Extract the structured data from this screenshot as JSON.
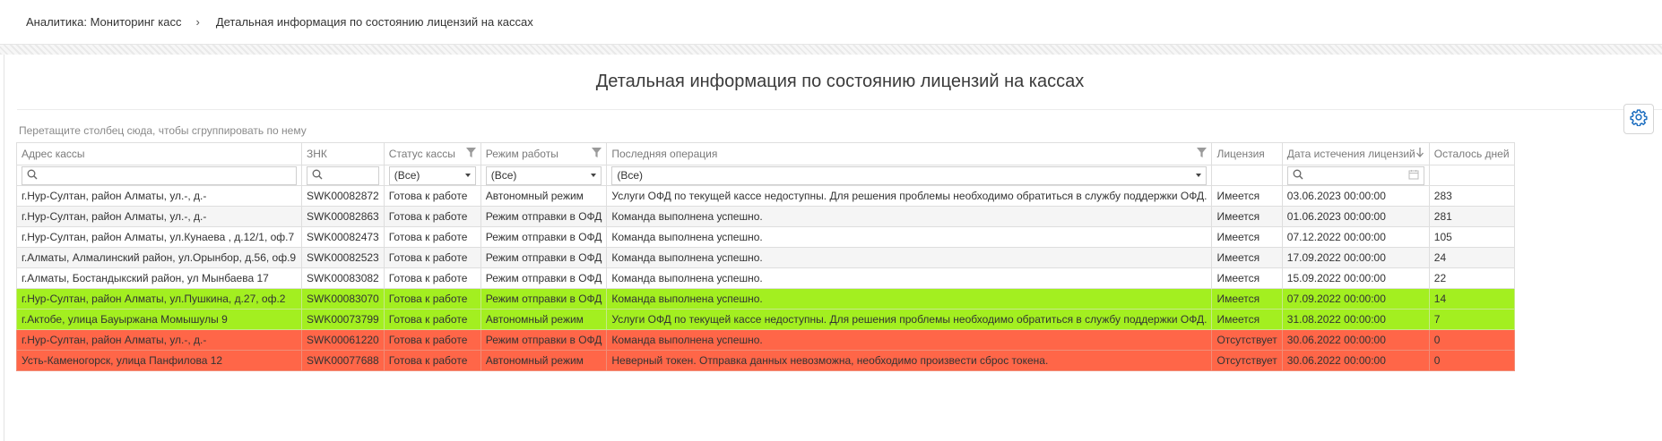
{
  "breadcrumb": {
    "items": [
      "Аналитика: Мониторинг касс",
      "Детальная информация по состоянию лицензий на кассах"
    ],
    "separator": "›"
  },
  "page": {
    "title": "Детальная информация по состоянию лицензий на кассах",
    "group_hint": "Перетащите столбец сюда, чтобы сгруппировать по нему"
  },
  "grid": {
    "columns": [
      "Адрес кассы",
      "ЗНК",
      "Статус кассы",
      "Режим работы",
      "Последняя операция",
      "Лицензия",
      "Дата истечения лицензий",
      "Осталось дней"
    ],
    "filters": {
      "status": "(Все)",
      "mode": "(Все)",
      "operation": "(Все)"
    },
    "rows": [
      {
        "address": "г.Нур-Султан, район Алматы, ул.-, д.-",
        "znk": "SWK00082872",
        "status": "Готова к работе",
        "mode": "Автономный режим",
        "operation": "Услуги ОФД по текущей кассе недоступны. Для решения проблемы необходимо обратиться в службу поддержки ОФД.",
        "license": "Имеется",
        "expires": "03.06.2023 00:00:00",
        "days": "283",
        "style": "white"
      },
      {
        "address": "г.Нур-Султан, район Алматы, ул.-, д.-",
        "znk": "SWK00082863",
        "status": "Готова к работе",
        "mode": "Режим отправки в ОФД",
        "operation": "Команда выполнена успешно.",
        "license": "Имеется",
        "expires": "01.06.2023 00:00:00",
        "days": "281",
        "style": "gray"
      },
      {
        "address": "г.Нур-Султан, район Алматы, ул.Кунаева , д.12/1, оф.7",
        "znk": "SWK00082473",
        "status": "Готова к работе",
        "mode": "Режим отправки в ОФД",
        "operation": "Команда выполнена успешно.",
        "license": "Имеется",
        "expires": "07.12.2022 00:00:00",
        "days": "105",
        "style": "white"
      },
      {
        "address": "г.Алматы, Алмалинский район, ул.Орынбор, д.56, оф.9",
        "znk": "SWK00082523",
        "status": "Готова к работе",
        "mode": "Режим отправки в ОФД",
        "operation": "Команда выполнена успешно.",
        "license": "Имеется",
        "expires": "17.09.2022 00:00:00",
        "days": "24",
        "style": "gray"
      },
      {
        "address": "г.Алматы, Бостандыкский район, ул Мынбаева 17",
        "znk": "SWK00083082",
        "status": "Готова к работе",
        "mode": "Режим отправки в ОФД",
        "operation": "Команда выполнена успешно.",
        "license": "Имеется",
        "expires": "15.09.2022 00:00:00",
        "days": "22",
        "style": "white"
      },
      {
        "address": "г.Нур-Султан, район Алматы, ул.Пушкина, д.27, оф.2",
        "znk": "SWK00083070",
        "status": "Готова к работе",
        "mode": "Режим отправки в ОФД",
        "operation": "Команда выполнена успешно.",
        "license": "Имеется",
        "expires": "07.09.2022 00:00:00",
        "days": "14",
        "style": "green"
      },
      {
        "address": "г.Актобе, улица Бауыржана Момышулы 9",
        "znk": "SWK00073799",
        "status": "Готова к работе",
        "mode": "Автономный режим",
        "operation": "Услуги ОФД по текущей кассе недоступны. Для решения проблемы необходимо обратиться в службу поддержки ОФД.",
        "license": "Имеется",
        "expires": "31.08.2022 00:00:00",
        "days": "7",
        "style": "green"
      },
      {
        "address": "г.Нур-Султан, район Алматы, ул.-, д.-",
        "znk": "SWK00061220",
        "status": "Готова к работе",
        "mode": "Режим отправки в ОФД",
        "operation": "Команда выполнена успешно.",
        "license": "Отсутствует",
        "expires": "30.06.2022 00:00:00",
        "days": "0",
        "style": "red"
      },
      {
        "address": "Усть-Каменогорск, улица Панфилова 12",
        "znk": "SWK00077688",
        "status": "Готова к работе",
        "mode": "Автономный режим",
        "operation": "Неверный токен. Отправка данных невозможна, необходимо произвести сброс токена.",
        "license": "Отсутствует",
        "expires": "30.06.2022 00:00:00",
        "days": "0",
        "style": "red"
      }
    ]
  },
  "colors": {
    "accent": "#1e6fc0",
    "row_green": "#a3ef20",
    "row_red": "#ff6648"
  },
  "icons": {
    "settings": "gear-icon",
    "search": "search-icon",
    "filter": "funnel-icon",
    "sort": "sort-down-icon",
    "calendar": "calendar-icon"
  }
}
